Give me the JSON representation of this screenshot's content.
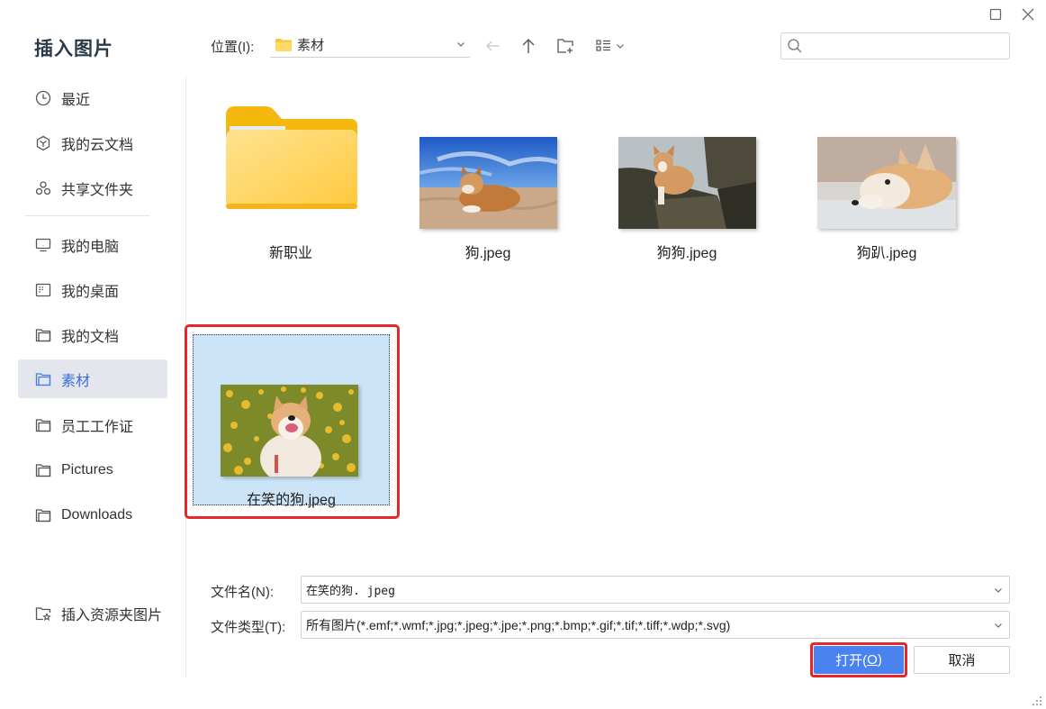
{
  "dialog": {
    "title": "插入图片",
    "window_controls": {
      "maximize": "maximize-icon",
      "close": "close-icon"
    }
  },
  "sidebar": {
    "items": [
      {
        "label": "最近",
        "icon": "clock-icon",
        "active": false
      },
      {
        "label": "我的云文档",
        "icon": "cloud-box-icon",
        "active": false
      },
      {
        "label": "共享文件夹",
        "icon": "share-nodes-icon",
        "active": false
      },
      {
        "label": "我的电脑",
        "icon": "monitor-icon",
        "active": false
      },
      {
        "label": "我的桌面",
        "icon": "desktop-icon",
        "active": false
      },
      {
        "label": "我的文档",
        "icon": "folder-icon",
        "active": false
      },
      {
        "label": "素材",
        "icon": "folder-icon",
        "active": true
      },
      {
        "label": "员工工作证",
        "icon": "folder-icon",
        "active": false
      },
      {
        "label": "Pictures",
        "icon": "folder-icon",
        "active": false
      },
      {
        "label": "Downloads",
        "icon": "folder-icon",
        "active": false
      }
    ],
    "footer_item": {
      "label": "插入资源夹图片",
      "icon": "folder-star-icon"
    }
  },
  "toolbar": {
    "location_label": "位置(I):",
    "location_value": "素材",
    "search_placeholder": ""
  },
  "files": [
    {
      "name": "新职业",
      "type": "folder"
    },
    {
      "name": "狗.jpeg",
      "type": "image",
      "scene": "corgi on beach, blue sky"
    },
    {
      "name": "狗狗.jpeg",
      "type": "image",
      "scene": "corgi puppy on rocks"
    },
    {
      "name": "狗趴.jpeg",
      "type": "image",
      "scene": "corgi lying on floor"
    },
    {
      "name": "在笑的狗.jpeg",
      "type": "image",
      "scene": "smiling corgi in yellow flowers",
      "selected": true
    }
  ],
  "form": {
    "filename_label": "文件名(N):",
    "filename_value": "在笑的狗. jpeg",
    "filetype_label": "文件类型(T):",
    "filetype_value": "所有图片(*.emf;*.wmf;*.jpg;*.jpeg;*.jpe;*.png;*.bmp;*.gif;*.tif;*.tiff;*.wdp;*.svg)"
  },
  "buttons": {
    "open_label": "打开(",
    "open_mnemonic": "O",
    "open_suffix": ")",
    "cancel_label": "取消"
  },
  "colors": {
    "accent": "#4a82f0",
    "selection_bg": "#cce4f7",
    "annotation_red": "#e8262a",
    "sidebar_active_bg": "#e3e6ec",
    "sidebar_active_text": "#3a6fd8"
  }
}
